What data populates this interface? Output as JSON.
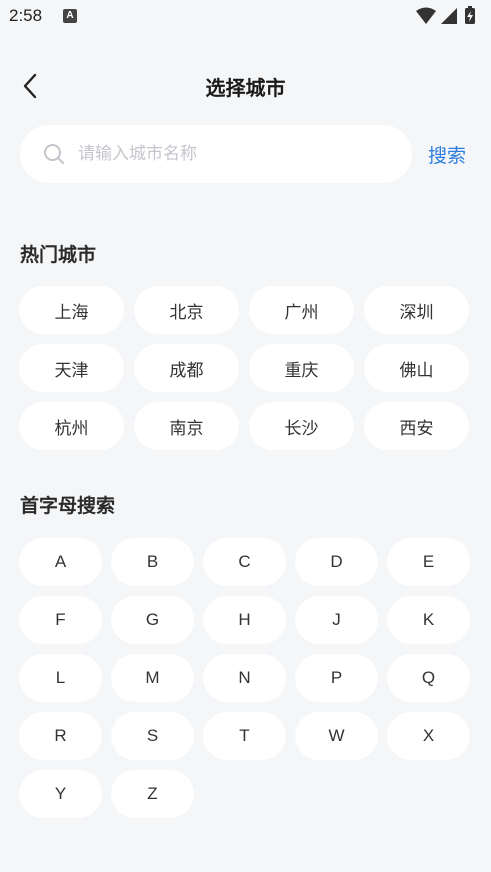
{
  "status_bar": {
    "time": "2:58",
    "notification_glyph": "A"
  },
  "header": {
    "title": "选择城市",
    "back_icon": "chevron-left-icon"
  },
  "search": {
    "placeholder": "请输入城市名称",
    "value": "",
    "button_label": "搜索"
  },
  "hot_cities": {
    "title": "热门城市",
    "items": [
      "上海",
      "北京",
      "广州",
      "深圳",
      "天津",
      "成都",
      "重庆",
      "佛山",
      "杭州",
      "南京",
      "长沙",
      "西安"
    ]
  },
  "letter_search": {
    "title": "首字母搜索",
    "letters": [
      "A",
      "B",
      "C",
      "D",
      "E",
      "F",
      "G",
      "H",
      "J",
      "K",
      "L",
      "M",
      "N",
      "P",
      "Q",
      "R",
      "S",
      "T",
      "W",
      "X",
      "Y",
      "Z"
    ]
  },
  "colors": {
    "accent": "#2e7de0",
    "background": "#f5f6f8",
    "chip": "#ffffff"
  }
}
